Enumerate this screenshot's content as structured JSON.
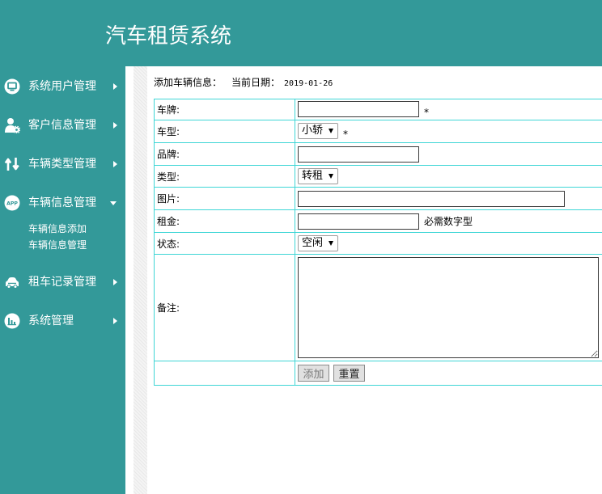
{
  "theme": {
    "primary_color": "#339999",
    "table_border_color": "#3fd6d6",
    "menu_text_color": "#ffffff"
  },
  "header": {
    "title": "汽车租赁系统"
  },
  "sidebar": {
    "items": [
      {
        "label": "系统用户管理",
        "icon": "monitor-icon",
        "expanded": false
      },
      {
        "label": "客户信息管理",
        "icon": "user-gear-icon",
        "expanded": false
      },
      {
        "label": "车辆类型管理",
        "icon": "swap-arrows-icon",
        "expanded": false
      },
      {
        "label": "车辆信息管理",
        "icon": "app-icon",
        "icon_text": "APP",
        "expanded": true,
        "children": [
          {
            "label": "车辆信息添加"
          },
          {
            "label": "车辆信息管理"
          }
        ]
      },
      {
        "label": "租车记录管理",
        "icon": "car-icon",
        "expanded": false
      },
      {
        "label": "系统管理",
        "icon": "bar-chart-icon",
        "expanded": false
      }
    ]
  },
  "main": {
    "heading": "添加车辆信息：",
    "date_label": "当前日期：",
    "date_value": "2019-01-26",
    "form": {
      "plate": {
        "label": "车牌:",
        "value": "",
        "required_mark": "*"
      },
      "model": {
        "label": "车型:",
        "selected": "小轿",
        "required_mark": "*"
      },
      "brand": {
        "label": "品牌:",
        "value": ""
      },
      "type": {
        "label": "类型:",
        "selected": "转租"
      },
      "image": {
        "label": "图片:",
        "value": ""
      },
      "rent": {
        "label": "租金:",
        "value": "",
        "hint": "必需数字型"
      },
      "status": {
        "label": "状态:",
        "selected": "空闲"
      },
      "remark": {
        "label": "备注:",
        "value": ""
      },
      "submit_label": "添加",
      "reset_label": "重置"
    }
  }
}
